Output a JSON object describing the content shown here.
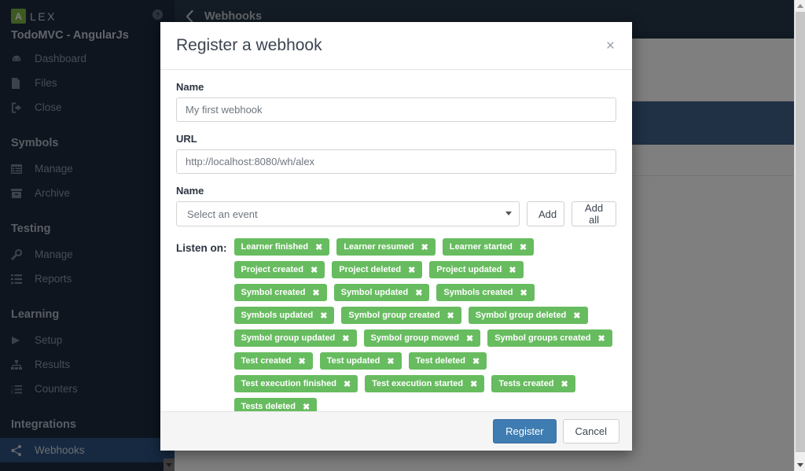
{
  "sidebar": {
    "brand": {
      "badge": "A",
      "name": "LEX",
      "help_icon": "help-circle-icon"
    },
    "project_name": "TodoMVC - AngularJs",
    "groups": [
      {
        "title": "",
        "items": [
          {
            "label": "Dashboard",
            "icon": "dashboard-icon",
            "active": false
          },
          {
            "label": "Files",
            "icon": "file-icon",
            "active": false
          },
          {
            "label": "Close",
            "icon": "exit-icon",
            "active": false
          }
        ]
      },
      {
        "title": "Symbols",
        "items": [
          {
            "label": "Manage",
            "icon": "table-icon",
            "active": false
          },
          {
            "label": "Archive",
            "icon": "archive-icon",
            "active": false
          }
        ]
      },
      {
        "title": "Testing",
        "items": [
          {
            "label": "Manage",
            "icon": "wrench-icon",
            "active": false
          },
          {
            "label": "Reports",
            "icon": "list-icon",
            "active": false
          }
        ]
      },
      {
        "title": "Learning",
        "items": [
          {
            "label": "Setup",
            "icon": "play-icon",
            "active": false
          },
          {
            "label": "Results",
            "icon": "sitemap-icon",
            "active": false
          },
          {
            "label": "Counters",
            "icon": "ordered-list-icon",
            "active": false
          }
        ]
      },
      {
        "title": "Integrations",
        "items": [
          {
            "label": "Webhooks",
            "icon": "share-nodes-icon",
            "active": true
          }
        ]
      }
    ]
  },
  "page": {
    "back_icon": "chevron-left-icon",
    "title": "Webhooks"
  },
  "modal": {
    "title": "Register a webhook",
    "close_label": "×",
    "fields": {
      "name_label": "Name",
      "name_value": "My first webhook",
      "url_label": "URL",
      "url_value": "http://localhost:8080/wh/alex",
      "event_label": "Name",
      "event_select_value": "Select an event",
      "add_button": "Add",
      "add_all_button": "Add all"
    },
    "listen_label": "Listen on:",
    "tags": [
      "Learner finished",
      "Learner resumed",
      "Learner started",
      "Project created",
      "Project deleted",
      "Project updated",
      "Symbol created",
      "Symbol updated",
      "Symbols created",
      "Symbols updated",
      "Symbol group created",
      "Symbol group deleted",
      "Symbol group updated",
      "Symbol group moved",
      "Symbol groups created",
      "Test created",
      "Test updated",
      "Test deleted",
      "Test execution finished",
      "Test execution started",
      "Tests created",
      "Tests deleted"
    ],
    "tag_remove_label": "✖",
    "footer": {
      "register_button": "Register",
      "cancel_button": "Cancel"
    }
  },
  "colors": {
    "sidebar_bg": "#1d2b3e",
    "sidebar_active": "#2c5282",
    "tag_green": "#67bc5f",
    "primary_blue": "#3e7cb1",
    "topbar_bg": "#263649"
  }
}
